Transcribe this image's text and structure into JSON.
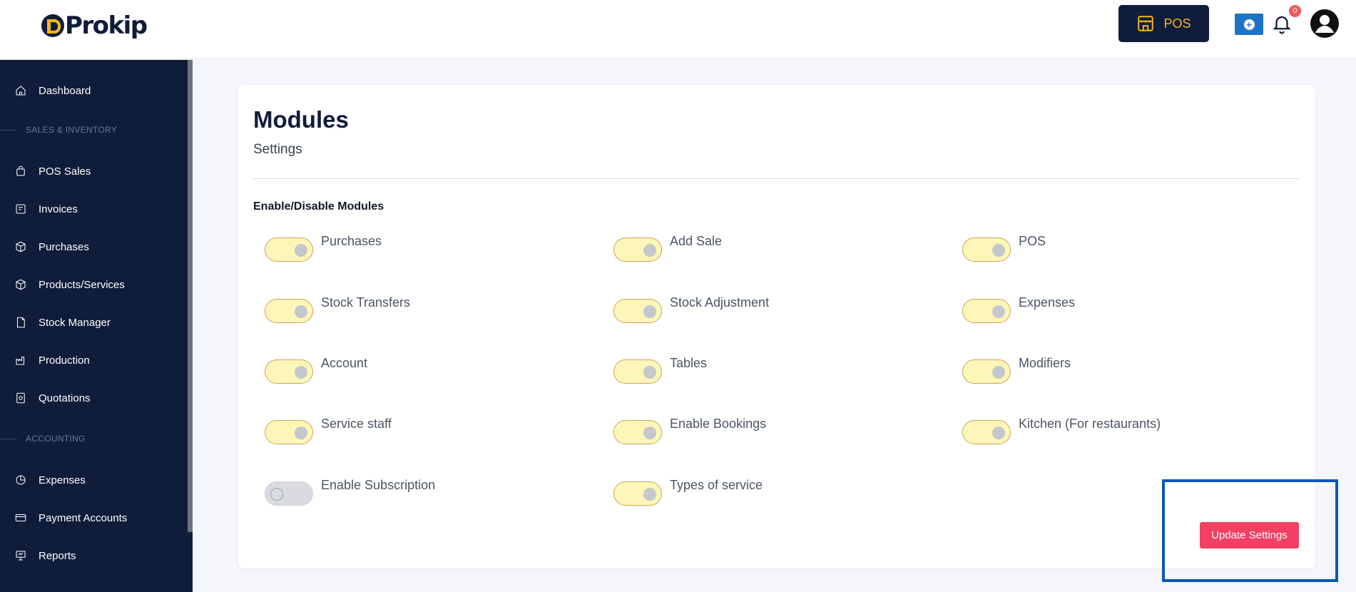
{
  "header": {
    "logo_text": "Prokip",
    "pos_label": "POS",
    "notification_count": "0",
    "colors": {
      "navy": "#0f1c3a",
      "gold": "#f5b81c",
      "blue": "#1d74c4",
      "badge": "#f05a5a"
    }
  },
  "sidebar": {
    "dashboard": "Dashboard",
    "section_sales": "SALES & INVENTORY",
    "pos_sales": "POS Sales",
    "invoices": "Invoices",
    "purchases": "Purchases",
    "products": "Products/Services",
    "stock_manager": "Stock Manager",
    "production": "Production",
    "quotations": "Quotations",
    "section_accounting": "ACCOUNTING",
    "expenses": "Expenses",
    "payment_accounts": "Payment Accounts",
    "reports": "Reports"
  },
  "page": {
    "title": "Modules",
    "subtitle": "Settings",
    "section_title": "Enable/Disable Modules",
    "update_button": "Update Settings"
  },
  "modules": {
    "purchases": {
      "label": "Purchases",
      "enabled": true
    },
    "add_sale": {
      "label": "Add Sale",
      "enabled": true
    },
    "pos": {
      "label": "POS",
      "enabled": true
    },
    "stock_transfers": {
      "label": "Stock Transfers",
      "enabled": true
    },
    "stock_adjustment": {
      "label": "Stock Adjustment",
      "enabled": true
    },
    "expenses": {
      "label": "Expenses",
      "enabled": true
    },
    "account": {
      "label": "Account",
      "enabled": true
    },
    "tables": {
      "label": "Tables",
      "enabled": true
    },
    "modifiers": {
      "label": "Modifiers",
      "enabled": true
    },
    "service_staff": {
      "label": "Service staff",
      "enabled": true
    },
    "enable_bookings": {
      "label": "Enable Bookings",
      "enabled": true
    },
    "kitchen": {
      "label": "Kitchen (For restaurants)",
      "enabled": true
    },
    "enable_subscription": {
      "label": "Enable Subscription",
      "enabled": false
    },
    "types_of_service": {
      "label": "Types of service",
      "enabled": true
    }
  }
}
